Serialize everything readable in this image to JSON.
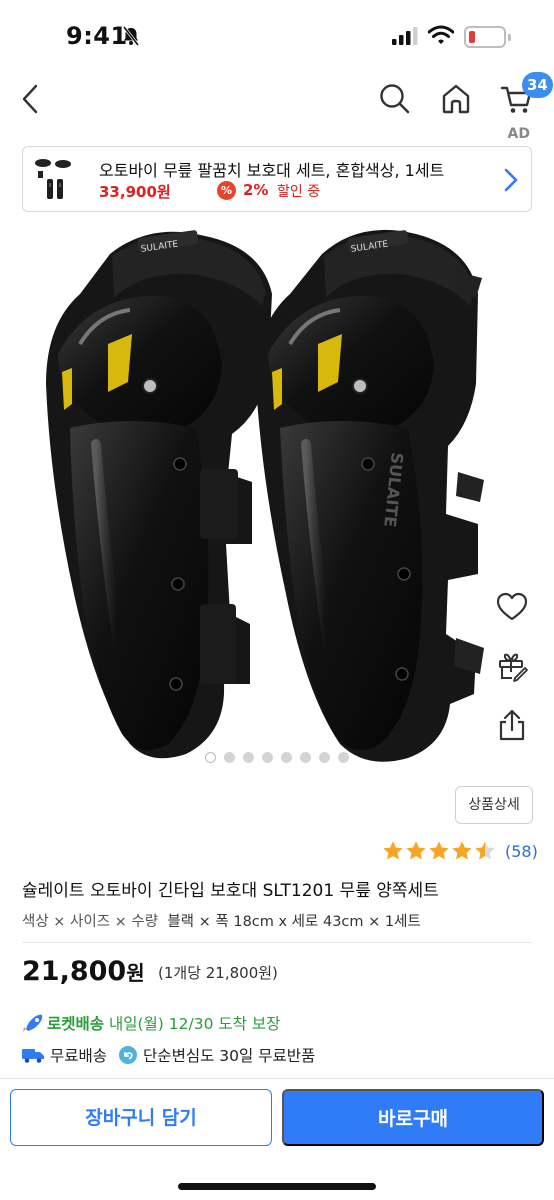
{
  "status_bar": {
    "time": "9:41"
  },
  "nav": {
    "cart_count": "34"
  },
  "ad": {
    "label": "AD",
    "title": "오토바이 무릎 팔꿈치 보호대 세트, 혼합색상, 1세트",
    "price": "33,900원",
    "discount_icon": "%",
    "discount": "2%",
    "discount_suffix": "할인 중"
  },
  "gallery": {
    "image_count": 8,
    "active_index": 0
  },
  "product": {
    "detail_button": "상품상세",
    "rating": 4.5,
    "review_count": "(58)",
    "title": "슐레이트 오토바이 긴타입 보호대 SLT1201 무릎 양쪽세트",
    "option_labels": "색상 × 사이즈 × 수량",
    "option_values": "블랙 × 폭 18cm x 세로 43cm × 1세트",
    "price_number": "21,800",
    "price_unit": "원",
    "unit_price": "(1개당 21,800원)"
  },
  "delivery": {
    "rocket_label": "로켓배송",
    "rocket_detail": "내일(월) 12/30 도착 보장",
    "free_shipping": "무료배송",
    "free_return": "단순변심도 30일 무료반품"
  },
  "actions": {
    "add_to_cart": "장바구니 담기",
    "buy_now": "바로구매"
  },
  "colors": {
    "accent": "#2f7cf6",
    "badge": "#3b8df0",
    "sale": "#e02020",
    "rocket_green": "#2a9d3a",
    "star": "#f5a623"
  },
  "icons": [
    "back-icon",
    "search-icon",
    "home-icon",
    "cart-icon",
    "heart-icon",
    "gift-icon",
    "share-icon",
    "chevron-right-icon",
    "truck-icon",
    "return-icon",
    "rocket-icon"
  ]
}
